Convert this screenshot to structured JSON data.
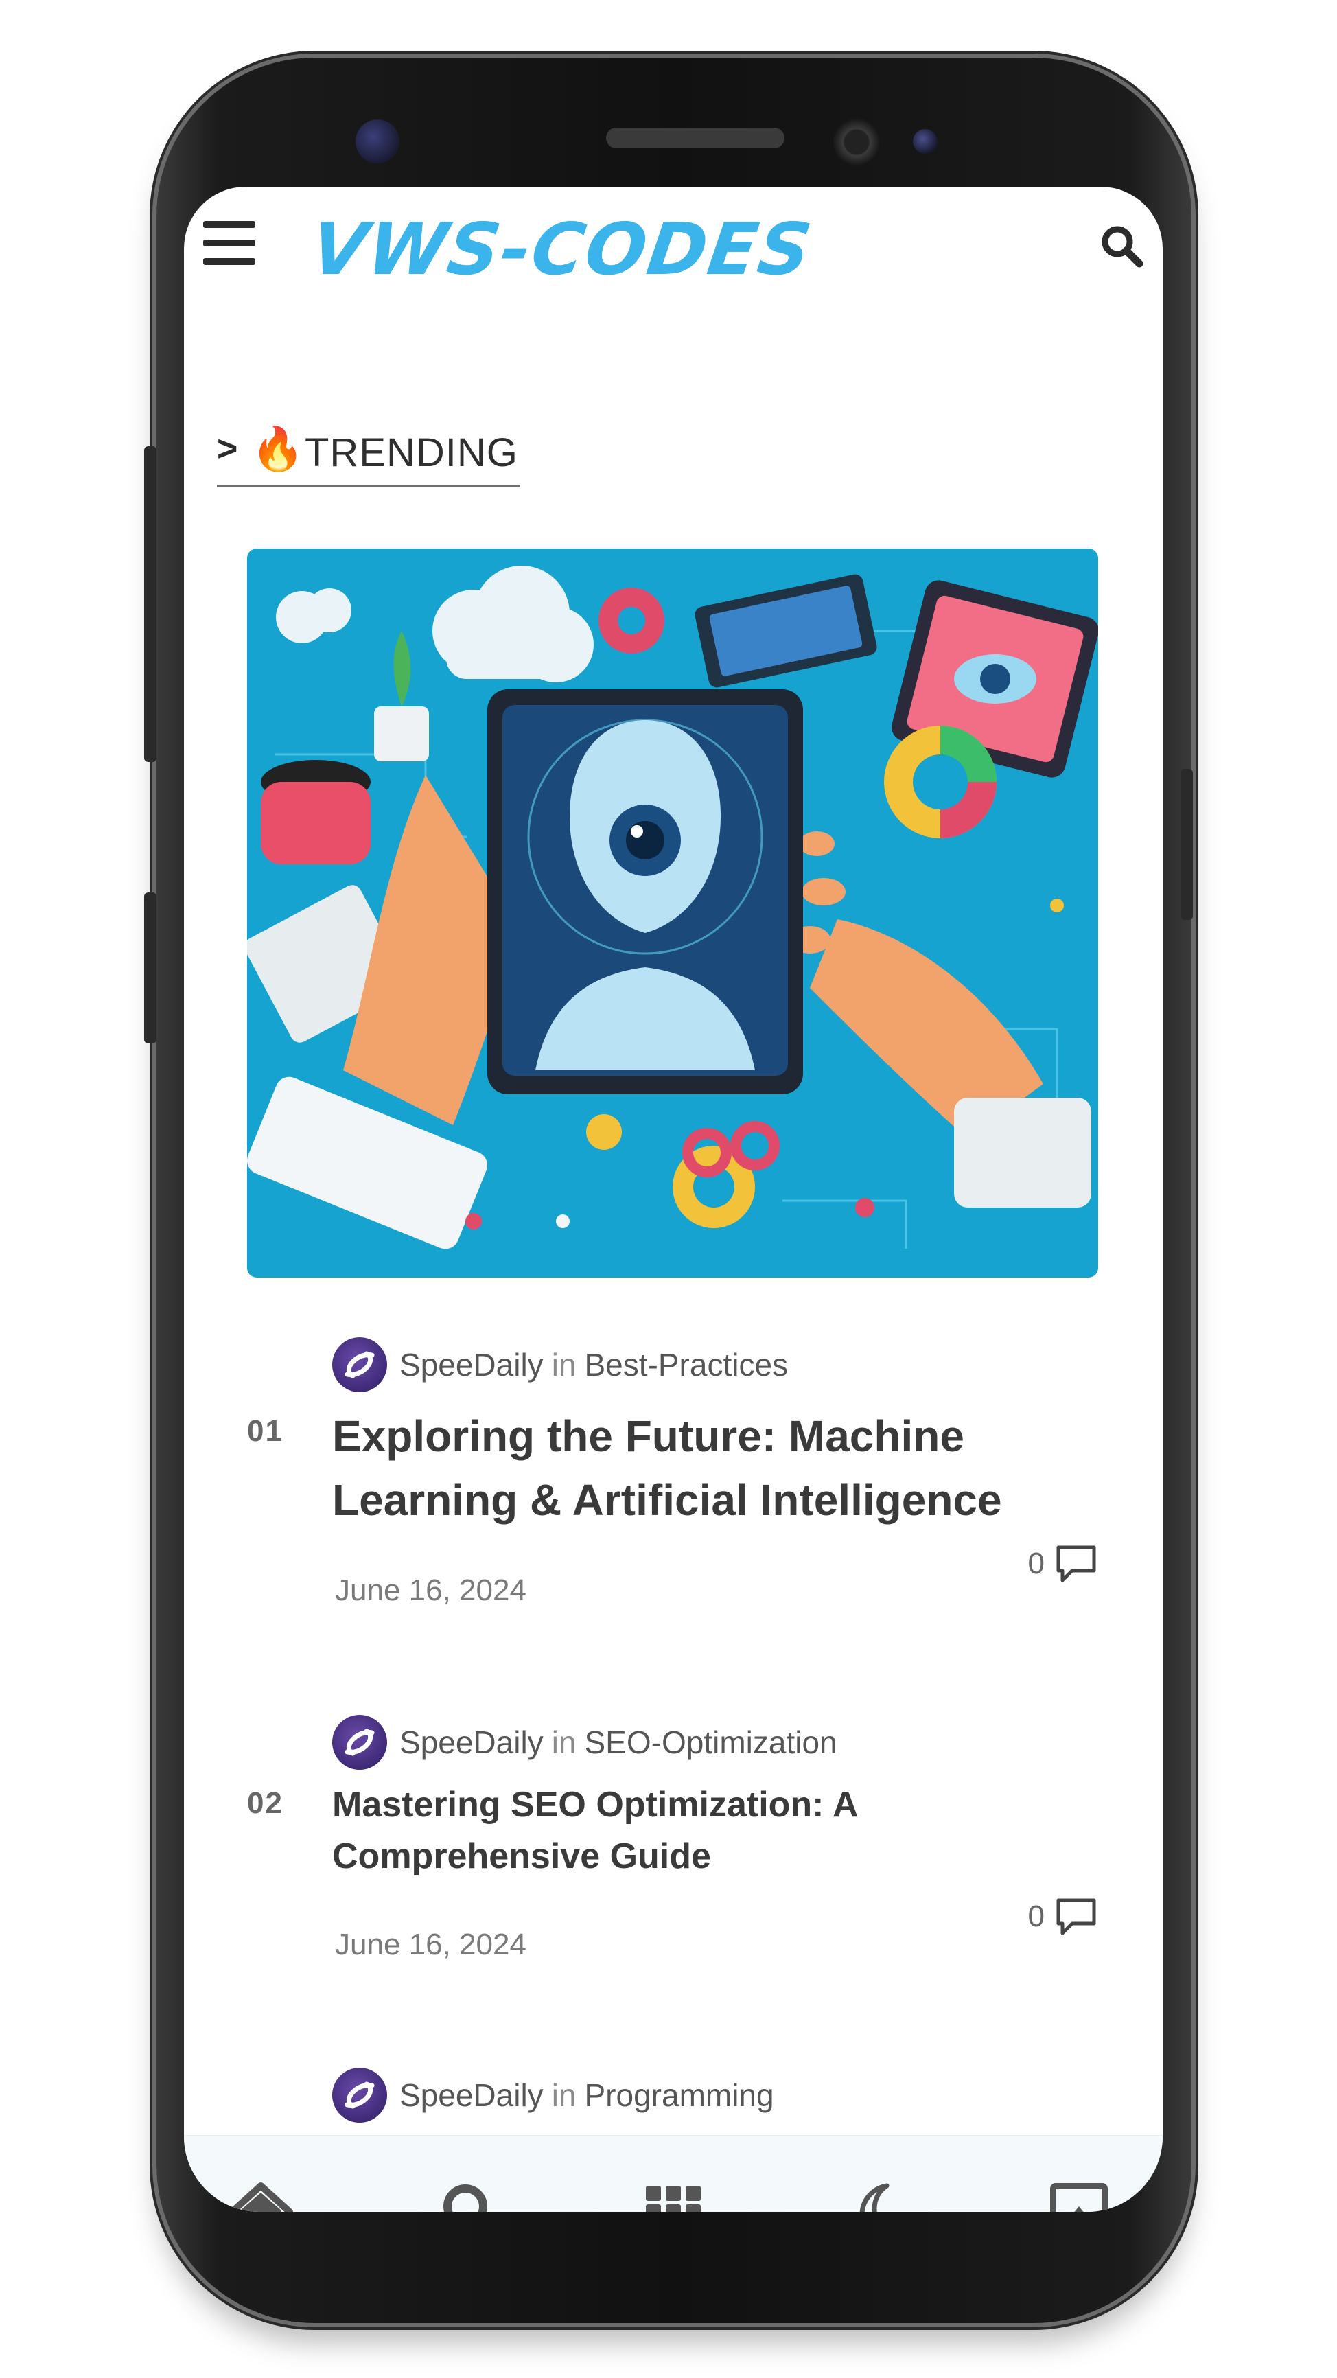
{
  "app": {
    "logo": "VWS-CODES",
    "colors": {
      "brand": "#3ab4ea",
      "text": "#3a3a3a",
      "nav_bg": "#f4f9fb"
    }
  },
  "header": {
    "menu_icon": "hamburger-icon",
    "search_icon": "search-icon"
  },
  "section": {
    "chevron": ">",
    "fire": "🔥",
    "label": "TRENDING"
  },
  "hero": {
    "image": "ai-illustration"
  },
  "posts": [
    {
      "num": "01",
      "author": "SpeeDaily",
      "in": "in",
      "category": "Best-Practices",
      "title": "Exploring the Future: Machine Learning & Artificial Intelligence",
      "date": "June 16, 2024",
      "comments": "0"
    },
    {
      "num": "02",
      "author": "SpeeDaily",
      "in": "in",
      "category": "SEO-Optimization",
      "title": "Mastering SEO Optimization: A Comprehensive Guide",
      "date": "June 16, 2024",
      "comments": "0"
    },
    {
      "author": "SpeeDaily",
      "in": "in",
      "category": "Programming"
    }
  ],
  "bottom_nav": [
    {
      "icon": "home-icon"
    },
    {
      "icon": "search-icon"
    },
    {
      "icon": "grid-icon"
    },
    {
      "icon": "moon-icon"
    },
    {
      "icon": "scroll-top-icon"
    }
  ]
}
